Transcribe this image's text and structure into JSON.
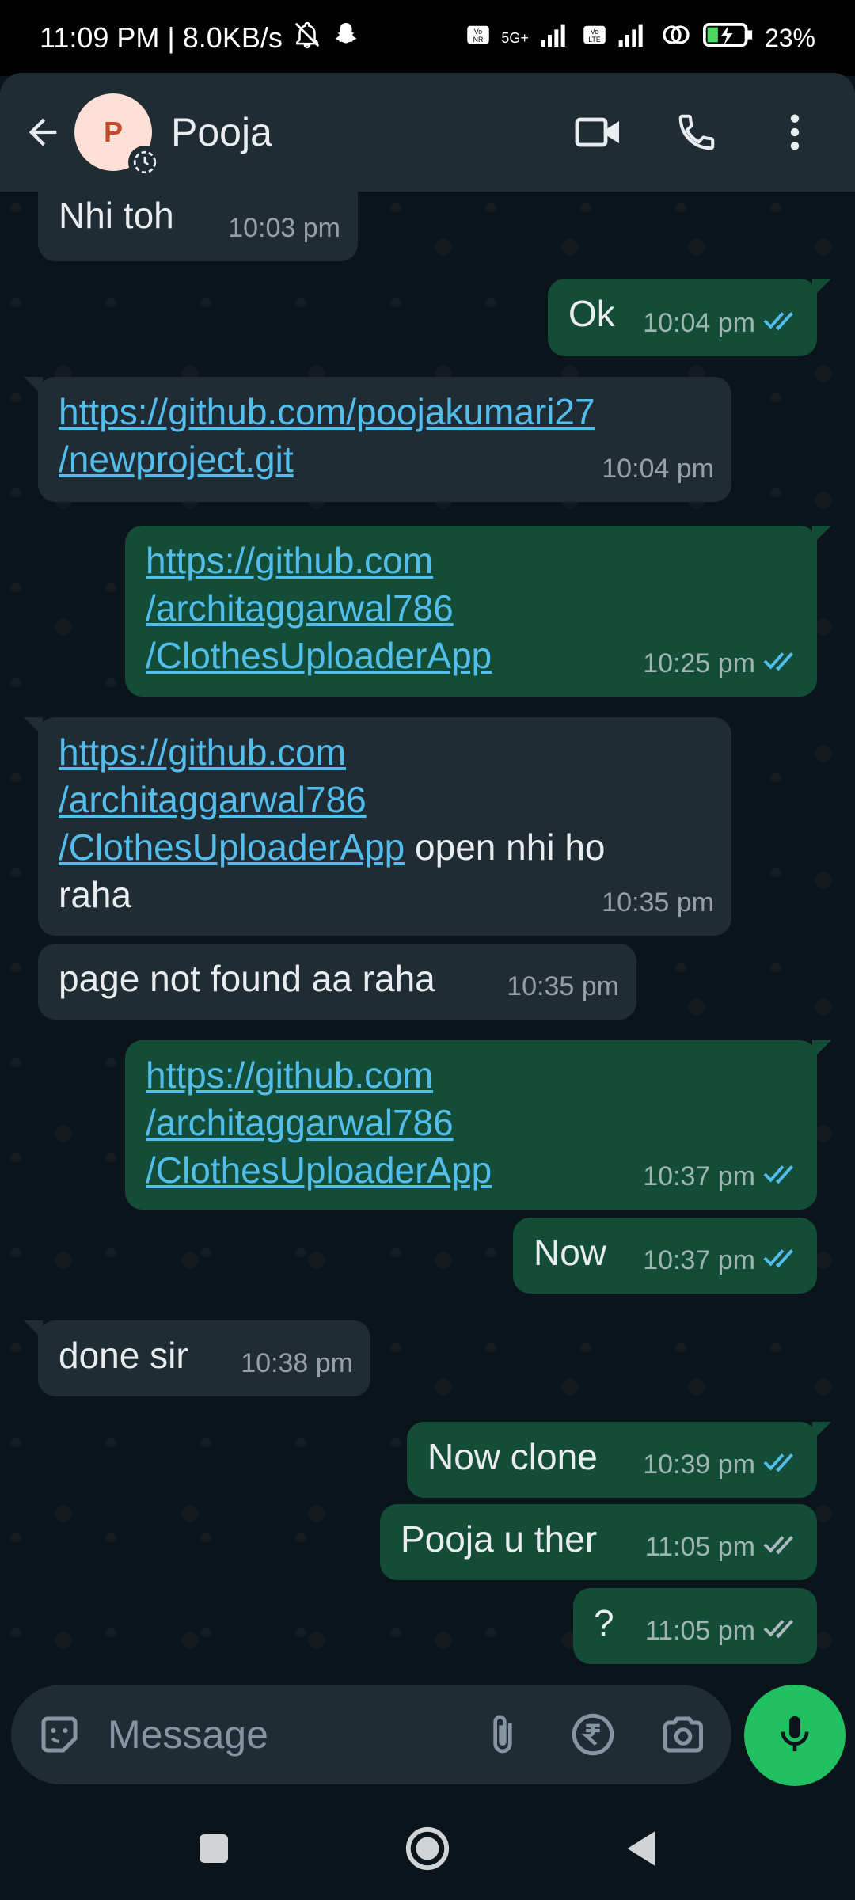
{
  "status_bar": {
    "time_and_speed": "11:09 PM | 8.0KB/s",
    "network_label": "5G+",
    "battery": "23%"
  },
  "header": {
    "avatar_letter": "P",
    "contact_name": "Pooja"
  },
  "messages": [
    {
      "dir": "in",
      "text": "Nhi toh",
      "time": "10:03 pm"
    },
    {
      "dir": "out",
      "text": "Ok",
      "time": "10:04 pm",
      "status": "read"
    },
    {
      "dir": "in",
      "link": "https://github.com/poojakumari27/newproject.git",
      "link_lines": [
        "https://github.com/poojakumari27",
        "/newproject.git"
      ],
      "time": "10:04 pm"
    },
    {
      "dir": "out",
      "link": "https://github.com/architaggarwal786/ClothesUploaderApp",
      "link_lines": [
        "https://github.com",
        "/architaggarwal786",
        "/ClothesUploaderApp"
      ],
      "time": "10:25 pm",
      "status": "read"
    },
    {
      "dir": "in",
      "link": "https://github.com/architaggarwal786/ClothesUploaderApp",
      "link_lines": [
        "https://github.com",
        "/architaggarwal786",
        "/ClothesUploaderApp"
      ],
      "text_after": " open nhi ho",
      "text_line2": "raha",
      "time": "10:35 pm"
    },
    {
      "dir": "in",
      "text": "page not found aa raha",
      "time": "10:35 pm"
    },
    {
      "dir": "out",
      "link": "https://github.com/architaggarwal786/ClothesUploaderApp",
      "link_lines": [
        "https://github.com",
        "/architaggarwal786",
        "/ClothesUploaderApp"
      ],
      "time": "10:37 pm",
      "status": "read"
    },
    {
      "dir": "out",
      "text": "Now",
      "time": "10:37 pm",
      "status": "read"
    },
    {
      "dir": "in",
      "text": "done sir",
      "time": "10:38 pm"
    },
    {
      "dir": "out",
      "text": "Now clone",
      "time": "10:39 pm",
      "status": "read"
    },
    {
      "dir": "out",
      "text": "Pooja u ther",
      "time": "11:05 pm",
      "status": "delivered"
    },
    {
      "dir": "out",
      "text": "?",
      "time": "11:05 pm",
      "status": "delivered"
    }
  ],
  "composer": {
    "placeholder": "Message"
  },
  "colors": {
    "incoming_bubble": "#1f2c34",
    "outgoing_bubble": "#144d37",
    "link": "#53bdeb",
    "read_tick": "#53bdeb",
    "delivered_tick": "#aebac1",
    "mic_button": "#21c063"
  },
  "icons": {
    "header": [
      "back-arrow-icon",
      "video-call-icon",
      "phone-icon",
      "more-vert-icon"
    ],
    "composer": [
      "sticker-icon",
      "attach-icon",
      "rupee-payment-icon",
      "camera-icon",
      "mic-icon"
    ],
    "navbar": [
      "recents-icon",
      "home-icon",
      "back-icon"
    ]
  }
}
